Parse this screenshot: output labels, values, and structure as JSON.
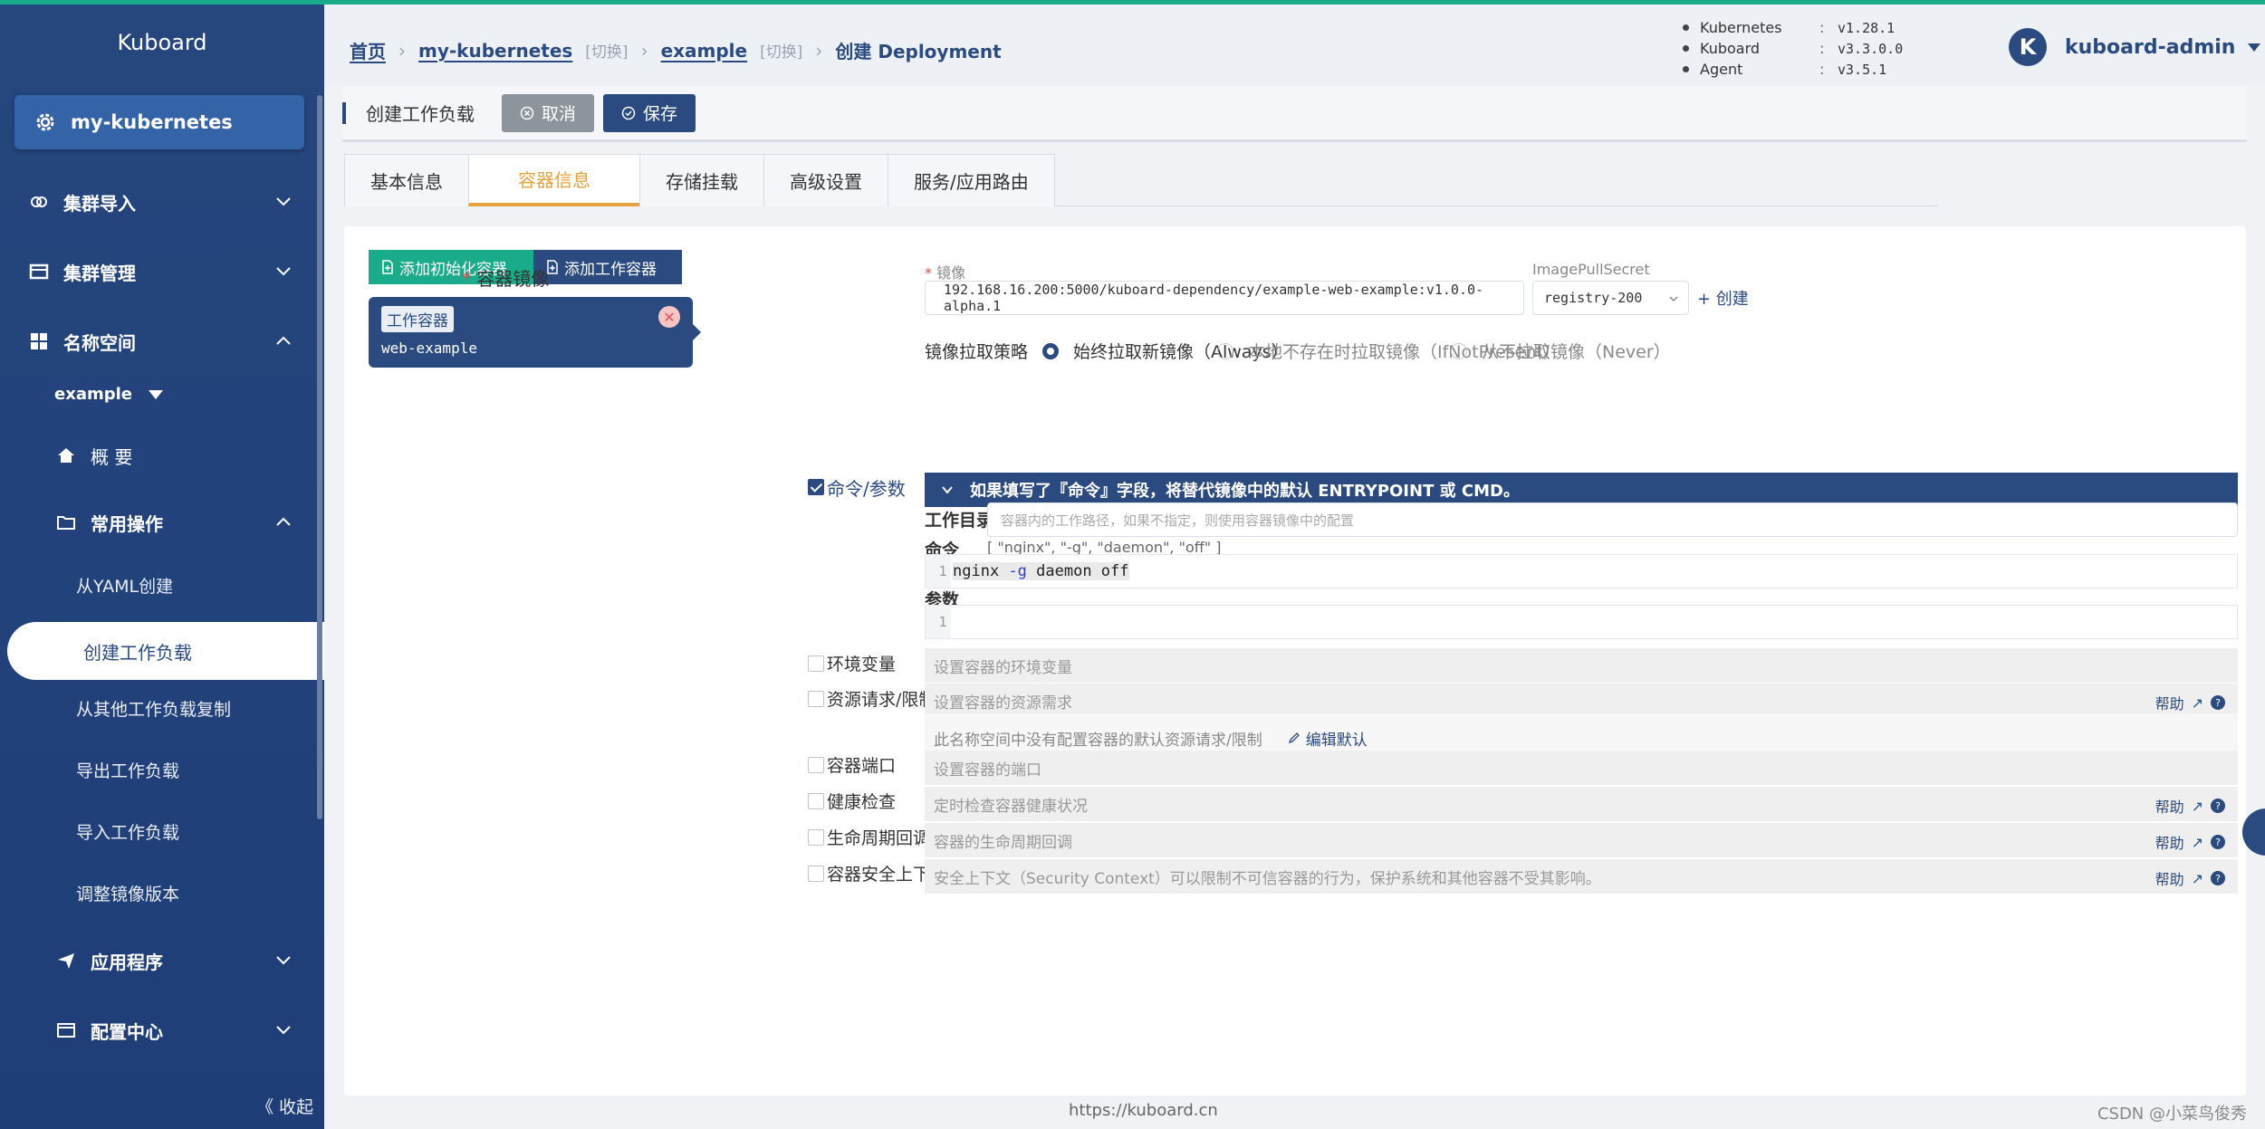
{
  "sidebar": {
    "logo": "Kuboard",
    "cluster": "my-kubernetes",
    "items": {
      "cluster_import": "集群导入",
      "cluster_manage": "集群管理",
      "namespace": "名称空间",
      "namespace_selected": "example",
      "overview": "概 要",
      "common_ops": "常用操作",
      "from_yaml": "从YAML创建",
      "create_workload": "创建工作负载",
      "copy_workload": "从其他工作负载复制",
      "export_workload": "导出工作负载",
      "import_workload": "导入工作负载",
      "adjust_image": "调整镜像版本",
      "apps": "应用程序",
      "config_center": "配置中心"
    },
    "collapse": "《 收起"
  },
  "header": {
    "breadcrumb": {
      "home": "首页",
      "cluster": "my-kubernetes",
      "switch": "[切换]",
      "namespace": "example",
      "current": "创建 Deployment"
    },
    "versions": [
      {
        "name": "Kubernetes",
        "colon": ":",
        "value": "v1.28.1"
      },
      {
        "name": "Kuboard",
        "colon": ":",
        "value": "v3.3.0.0"
      },
      {
        "name": "Agent",
        "colon": ":",
        "value": "v3.5.1"
      }
    ],
    "user": {
      "initial": "K",
      "name": "kuboard-admin"
    }
  },
  "toolbar": {
    "title": "创建工作负载",
    "cancel": "取消",
    "save": "保存"
  },
  "tabs": [
    "基本信息",
    "容器信息",
    "存储挂载",
    "高级设置",
    "服务/应用路由"
  ],
  "containers": {
    "add_init": "添加初始化容器",
    "add_work": "添加工作容器",
    "badge": "工作容器",
    "name": "web-example"
  },
  "form": {
    "image_label": "容器镜像",
    "image_sub": "镜像",
    "image_value": "192.168.16.200:5000/kuboard-dependency/example-web-example:v1.0.0-alpha.1",
    "pull_secret_label": "ImagePullSecret",
    "pull_secret_value": "registry-200",
    "create": "+ 创建",
    "pull_policy_label": "镜像拉取策略",
    "pull_always": "始终拉取新镜像（Always）",
    "pull_ifnotpresent": "本地不存在时拉取镜像（IfNotPresent）",
    "pull_never": "从不拉取镜像（Never）",
    "cmd_label": "命令/参数",
    "cmd_banner": "如果填写了『命令』字段，将替代镜像中的默认 ENTRYPOINT 或 CMD。",
    "workdir_label": "工作目录",
    "workdir_placeholder": "容器内的工作路径，如果不指定，则使用容器镜像中的配置",
    "command_label": "命令",
    "command_hint": "[ \"nginx\", \"-g\", \"daemon\", \"off\" ]",
    "command_line_no": "1",
    "command_code_a": "nginx ",
    "command_code_flag": "-g",
    "command_code_b": " daemon off",
    "args_label": "参数",
    "args_line_no": "1",
    "env_label": "环境变量",
    "env_hint": "设置容器的环境变量",
    "res_label": "资源请求/限制",
    "res_hint": "设置容器的资源需求",
    "res_note": "此名称空间中没有配置容器的默认资源请求/限制",
    "res_edit": "编辑默认",
    "port_label": "容器端口",
    "port_hint": "设置容器的端口",
    "health_label": "健康检查",
    "health_hint": "定时检查容器健康状况",
    "life_label": "生命周期回调",
    "life_hint": "容器的生命周期回调",
    "sec_label": "容器安全上下文",
    "sec_hint": "安全上下文（Security Context）可以限制不可信容器的行为，保护系统和其他容器不受其影响。",
    "help": "帮助"
  },
  "footer": {
    "url": "https://kuboard.cn",
    "watermark": "CSDN @小菜鸟俊秀"
  },
  "colors": {
    "primary": "#2a4a80",
    "accent": "#e6a23c",
    "green": "#1aab8a"
  }
}
